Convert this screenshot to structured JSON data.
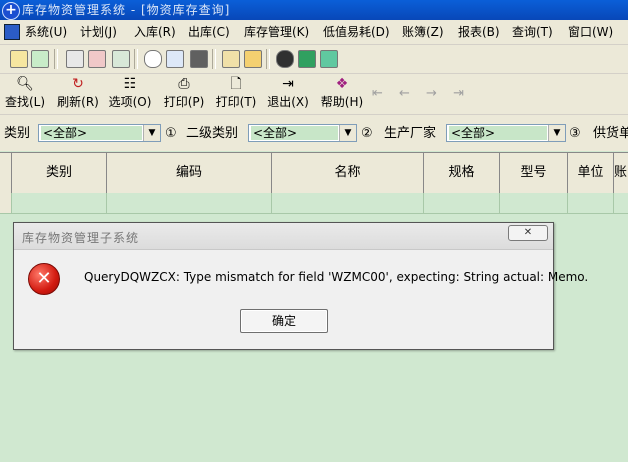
{
  "window": {
    "title": "库存物资管理系统 - [物资库存查询]"
  },
  "menu": {
    "items": [
      "系统(U)",
      "计划(J)",
      "入库(R)",
      "出库(C)",
      "库存管理(K)",
      "低值易耗(D)",
      "账簿(Z)",
      "报表(B)",
      "查询(T)",
      "窗口(W)"
    ]
  },
  "toolbar": {
    "find": "查找(L)",
    "refresh": "刷新(R)",
    "options": "选项(O)",
    "print_p": "打印(P)",
    "print_t": "打印(T)",
    "exit": "退出(X)",
    "help": "帮助(H)"
  },
  "filters": {
    "category_label": "类别",
    "category_value": "<全部>",
    "sub_category_label": "二级类别",
    "sub_category_value": "<全部>",
    "manufacturer_label": "生产厂家",
    "manufacturer_value": "<全部>",
    "supplier_label": "供货单",
    "marker1": "①",
    "marker2": "②",
    "marker3": "③"
  },
  "grid": {
    "columns": [
      "类别",
      "编码",
      "名称",
      "规格",
      "型号",
      "单位",
      "账"
    ]
  },
  "dialog": {
    "title": "库存物资管理子系统",
    "message": "QueryDQWZCX: Type mismatch for field 'WZMC00', expecting: String actual: Memo.",
    "ok_label": "确定"
  },
  "colors": {
    "title_bar": "#0847b8",
    "grid_background": "#d0e8d0",
    "combo_value_bg": "#c8e6c8",
    "error_icon": "#d21a10"
  }
}
